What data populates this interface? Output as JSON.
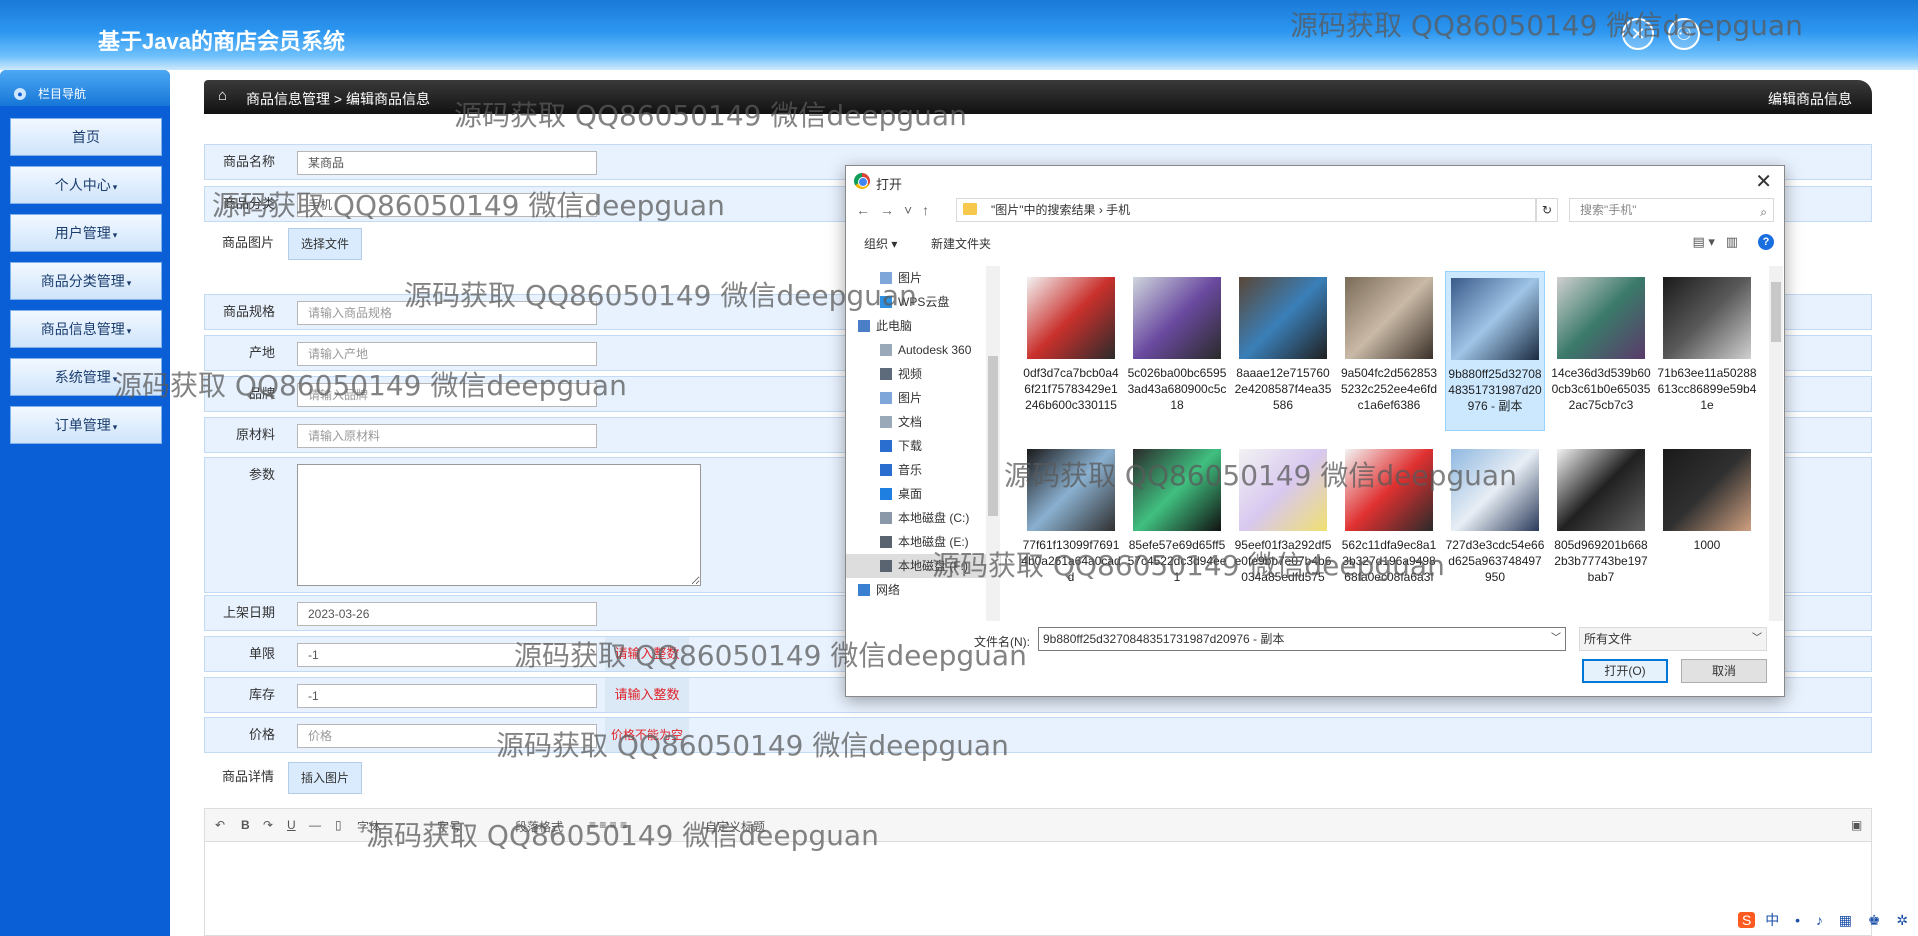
{
  "header": {
    "title": "基于Java的商店会员系统"
  },
  "sidebar": {
    "nav_title": "栏目导航",
    "items": [
      {
        "label": "首页",
        "caret": ""
      },
      {
        "label": "个人中心",
        "caret": "▾"
      },
      {
        "label": "用户管理",
        "caret": "▾"
      },
      {
        "label": "商品分类管理",
        "caret": "▾"
      },
      {
        "label": "商品信息管理",
        "caret": "▾"
      },
      {
        "label": "系统管理",
        "caret": "▾"
      },
      {
        "label": "订单管理",
        "caret": "▾"
      }
    ]
  },
  "breadcrumb": {
    "path": "商品信息管理 > 编辑商品信息",
    "right": "编辑商品信息"
  },
  "form": {
    "name_label": "商品名称",
    "name_value": "某商品",
    "category_label": "商品分类",
    "category_value": "手机",
    "image_label": "商品图片",
    "image_button": "选择文件",
    "spec_label": "商品规格",
    "spec_placeholder": "请输入商品规格",
    "origin_label": "产地",
    "origin_placeholder": "请输入产地",
    "brand_label": "品牌",
    "brand_placeholder": "请输入品牌",
    "material_label": "原材料",
    "material_placeholder": "请输入原材料",
    "params_label": "参数",
    "date_label": "上架日期",
    "date_value": "2023-03-26",
    "limit_label": "单限",
    "limit_value": "-1",
    "limit_warn": "请输入整数",
    "stock_label": "库存",
    "stock_value": "-1",
    "stock_warn": "请输入整数",
    "price_label": "价格",
    "price_placeholder": "价格",
    "price_warn": "价格不能为空",
    "detail_label": "商品详情",
    "detail_button": "插入图片"
  },
  "editor": {
    "font_label": "字体",
    "size_label": "字号",
    "para_label": "段落格式",
    "custom_label": "自定义标题"
  },
  "dialog": {
    "title": "打开",
    "address": "\"图片\"中的搜索结果  ›  手机",
    "search_placeholder": "搜索\"手机\"",
    "organize": "组织 ▾",
    "new_folder": "新建文件夹",
    "tree": [
      "图片",
      "WPS云盘",
      "此电脑",
      "Autodesk 360",
      "视频",
      "图片",
      "文档",
      "下载",
      "音乐",
      "桌面",
      "本地磁盘 (C:)",
      "本地磁盘 (E:)",
      "本地磁盘 (F:)",
      "网络"
    ],
    "files": [
      "0df3d7ca7bcb0a46f21f75783429e1246b600c330115",
      "5c026ba00bc65953ad43a680900c5c18",
      "8aaae12e7157602e4208587f4ea35586",
      "9a504fc2d5628535232c252ee4e6fdc1a6ef6386",
      "9b880ff25d3270848351731987d20976 - 副本",
      "14ce36d3d539b600cb3c61b0e650352ac75cb7c3",
      "71b63ee11a50288613cc86899e59b41e",
      "77f61f13099f76914b0a261a64a0cadd",
      "85efe57e69d65ff557c4522dc3d94ee1",
      "95eef01f3a292df5e0fe9bb7e07b4b6034a85edfd575",
      "562c11dfa9ec8a13b327d196a949868fa0ec08fa6a3f",
      "727d3e3cdc54e66d625a963748497950",
      "805d969201b6682b3b77743be197bab7",
      "1000"
    ],
    "filename_label": "文件名(N):",
    "filename_value": "9b880ff25d3270848351731987d20976 - 副本",
    "filetype_value": "所有文件",
    "open_button": "打开(O)",
    "cancel_button": "取消"
  },
  "watermark": "源码获取 QQ86050149 微信deepguan",
  "taskbar": {
    "ime": "中"
  }
}
